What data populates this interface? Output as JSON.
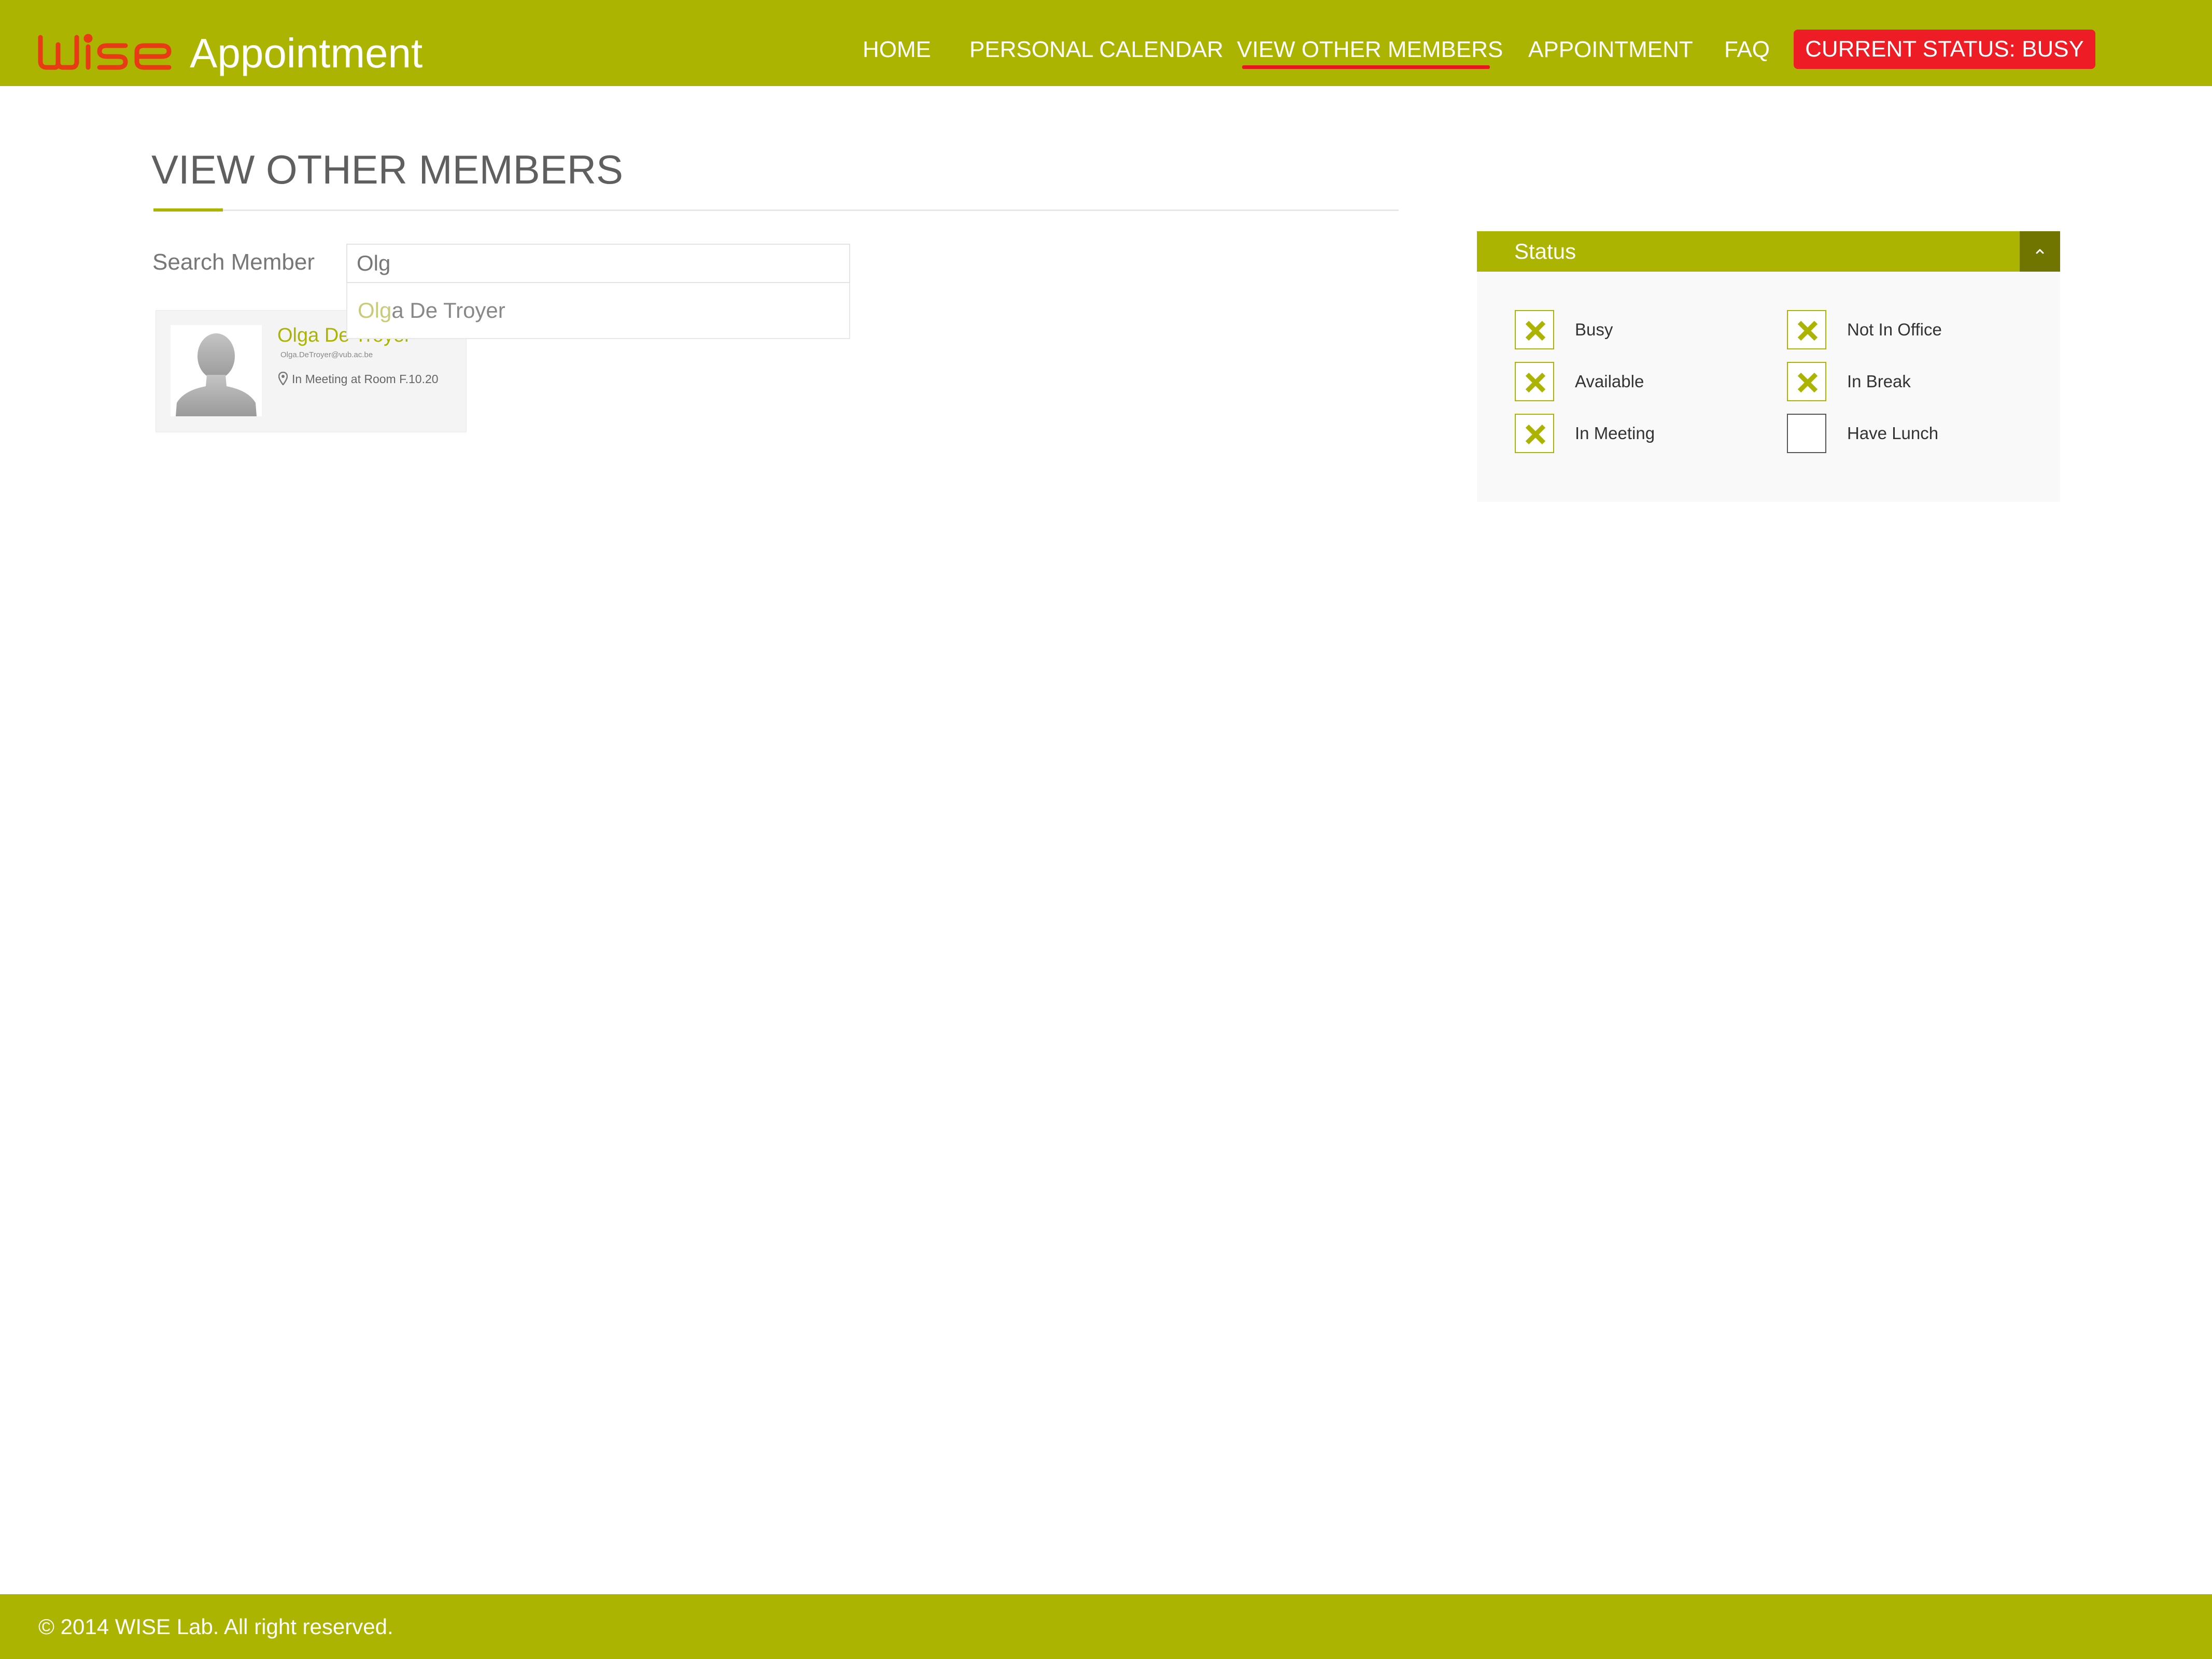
{
  "header": {
    "logo_text": "WISE",
    "title": "Appointment",
    "nav": [
      {
        "label": "HOME",
        "active": false
      },
      {
        "label": "PERSONAL CALENDAR",
        "active": false
      },
      {
        "label": "VIEW OTHER MEMBERS",
        "active": true
      },
      {
        "label": "APPOINTMENT",
        "active": false
      },
      {
        "label": "FAQ",
        "active": false
      }
    ],
    "status_button": "CURRENT STATUS: BUSY"
  },
  "main": {
    "page_title": "VIEW OTHER MEMBERS",
    "search": {
      "label": "Search Member",
      "value": "Olg",
      "suggestion_match": "Olg",
      "suggestion_rest": "a De Troyer"
    },
    "member": {
      "name": "Olga De Troyer",
      "email": "Olga.DeTroyer@vub.ac.be",
      "location": "In Meeting at Room F.10.20"
    }
  },
  "status_panel": {
    "title": "Status",
    "filters": [
      {
        "label": "Busy",
        "checked": true
      },
      {
        "label": "Not In Office",
        "checked": true
      },
      {
        "label": "Available",
        "checked": true
      },
      {
        "label": "In Break",
        "checked": true
      },
      {
        "label": "In Meeting",
        "checked": true
      },
      {
        "label": "Have Lunch",
        "checked": false
      }
    ]
  },
  "footer": {
    "copyright": "© 2014 WISE Lab. All right reserved."
  },
  "colors": {
    "brand": "#abb400",
    "brand_dark": "#707500",
    "alert": "#ee1c25",
    "logo": "#e83a14"
  }
}
